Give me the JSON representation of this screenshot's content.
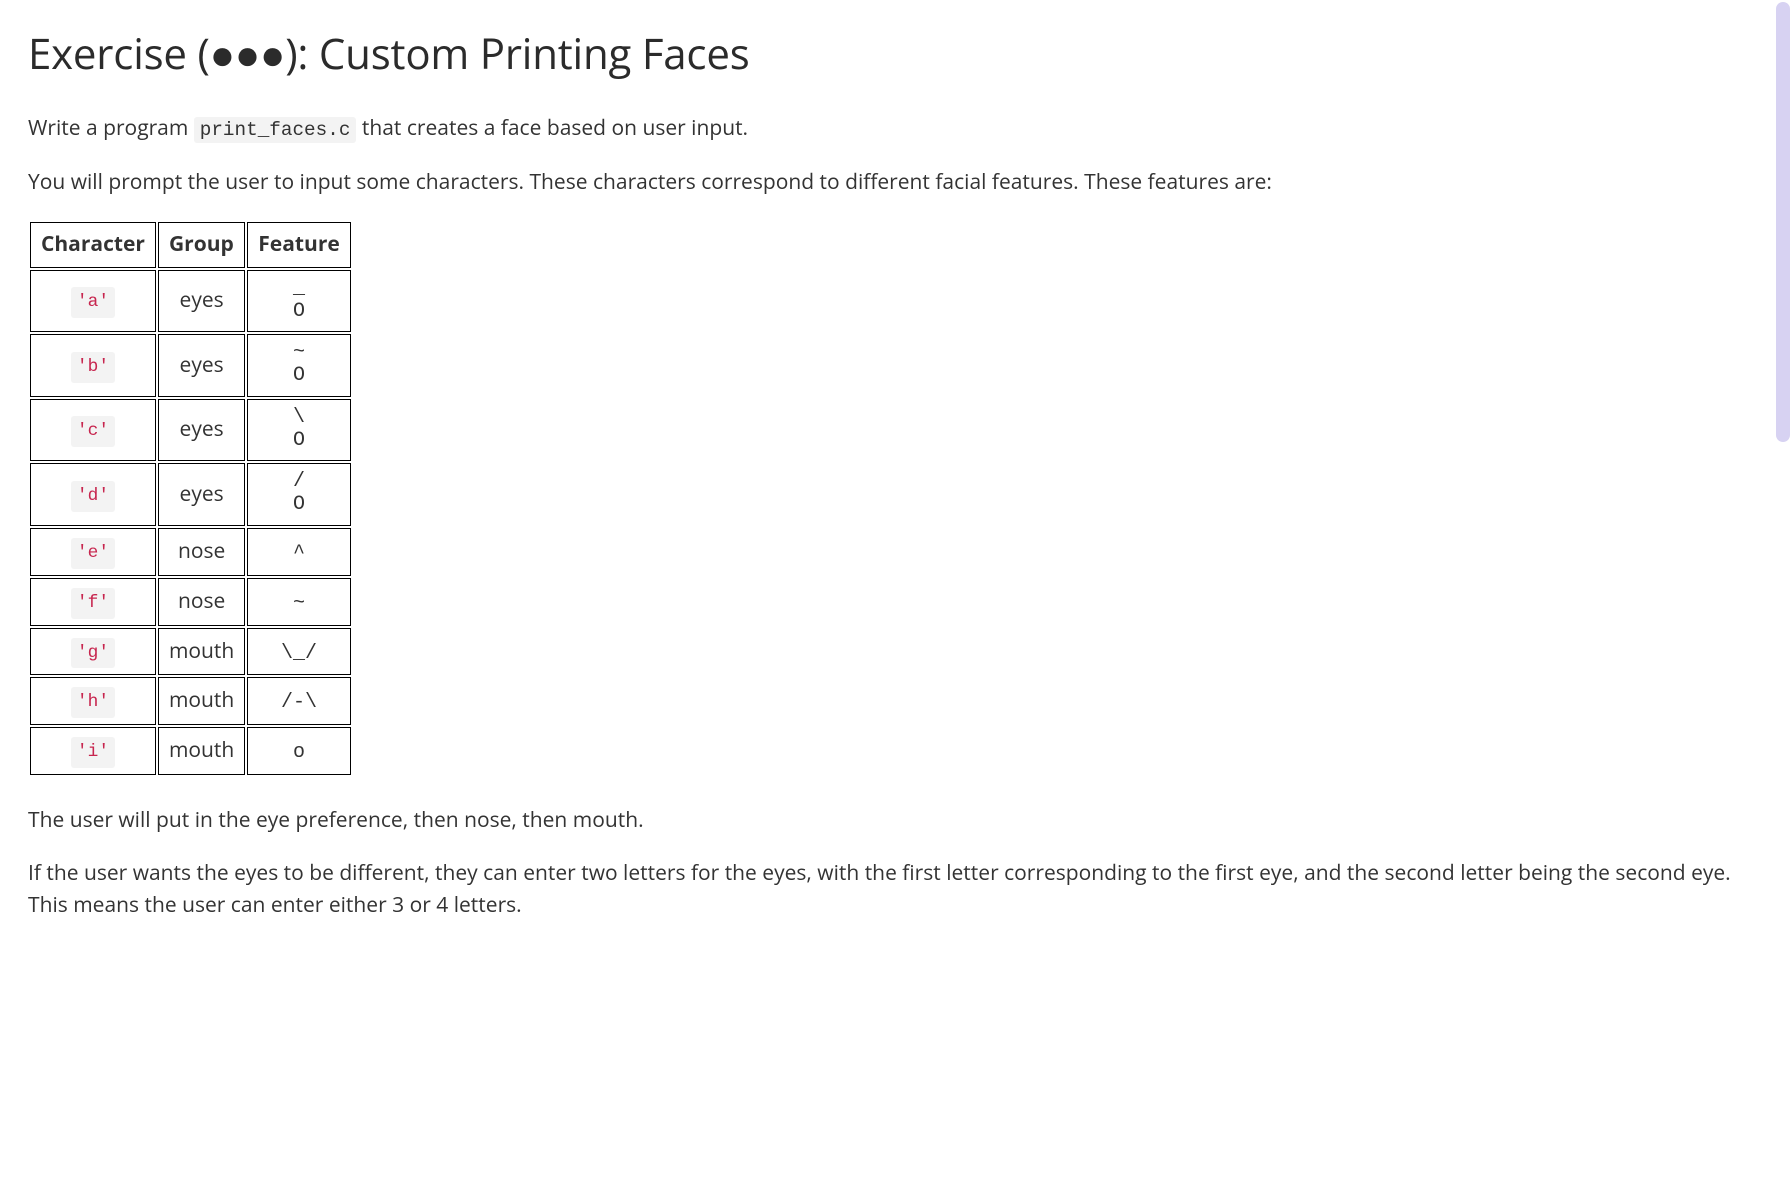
{
  "title": "Exercise (●●●): Custom Printing Faces",
  "intro": {
    "p1_a": "Write a program ",
    "p1_code": "print_faces.c",
    "p1_b": " that creates a face based on user input.",
    "p2": "You will prompt the user to input some characters. These characters correspond to different facial features. These features are:"
  },
  "table": {
    "headers": {
      "c0": "Character",
      "c1": "Group",
      "c2": "Feature"
    },
    "rows": [
      {
        "char": "'a'",
        "group": "eyes",
        "feature": "_\nO"
      },
      {
        "char": "'b'",
        "group": "eyes",
        "feature": "~\nO"
      },
      {
        "char": "'c'",
        "group": "eyes",
        "feature": "\\\nO"
      },
      {
        "char": "'d'",
        "group": "eyes",
        "feature": "/\nO"
      },
      {
        "char": "'e'",
        "group": "nose",
        "feature": "^"
      },
      {
        "char": "'f'",
        "group": "nose",
        "feature": "~"
      },
      {
        "char": "'g'",
        "group": "mouth",
        "feature": "\\_/"
      },
      {
        "char": "'h'",
        "group": "mouth",
        "feature": "/-\\"
      },
      {
        "char": "'i'",
        "group": "mouth",
        "feature": "o"
      }
    ]
  },
  "outro": {
    "p3": "The user will put in the eye preference, then nose, then mouth.",
    "p4": "If the user wants the eyes to be different, they can enter two letters for the eyes, with the first letter corresponding to the first eye, and the second letter being the second eye. This means the user can enter either 3 or 4 letters."
  }
}
